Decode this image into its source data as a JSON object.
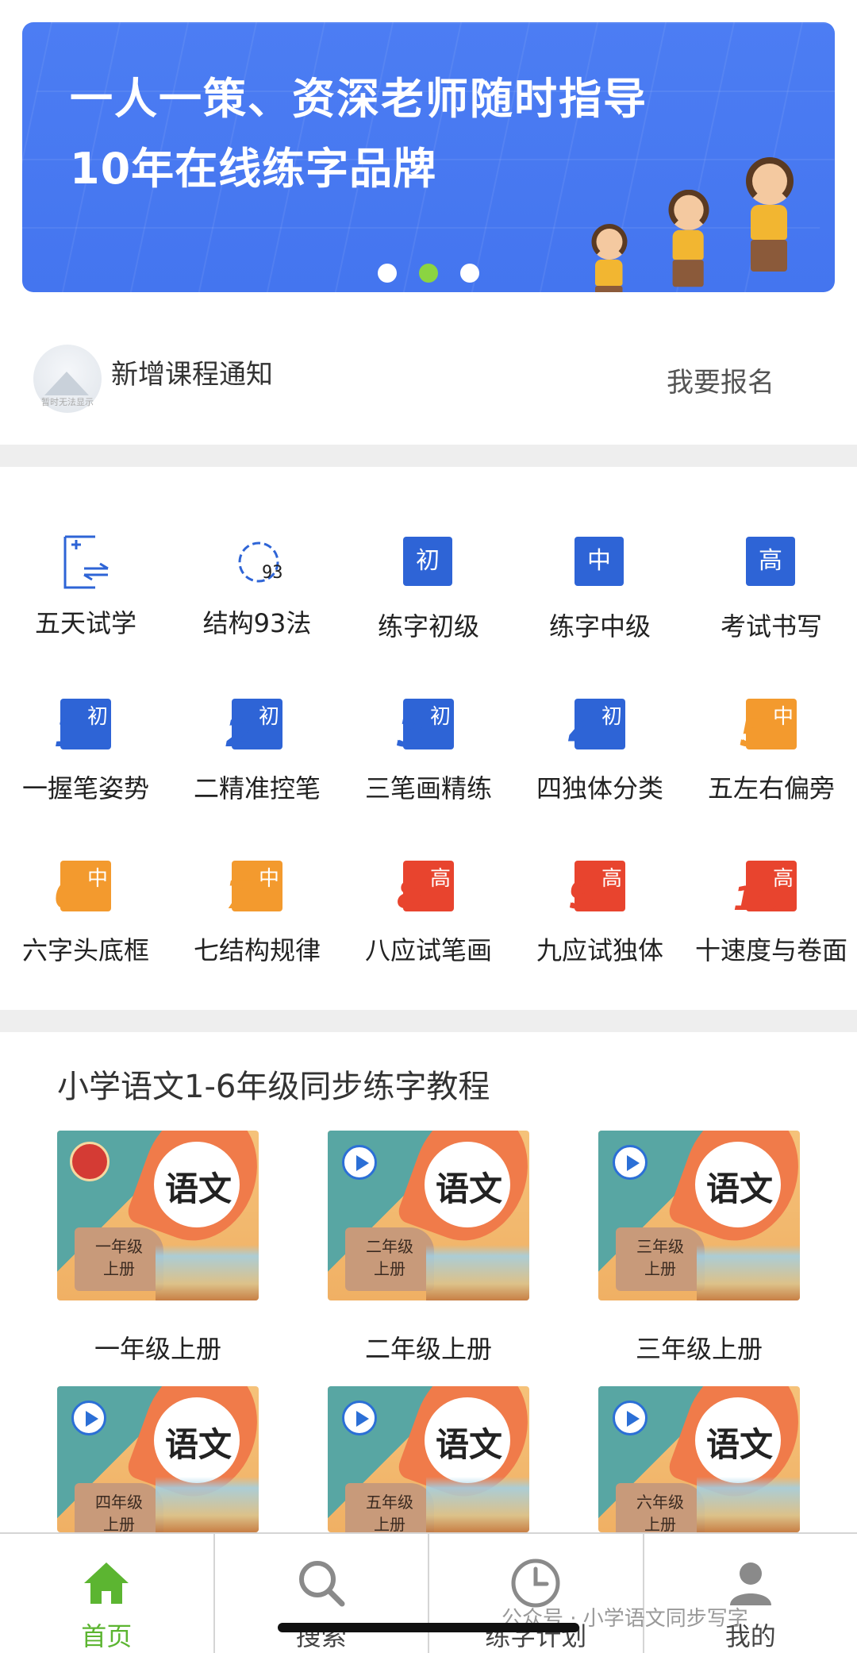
{
  "banner": {
    "line1": "一人一策、资深老师随时指导",
    "line2": "10年在线练字品牌",
    "dots": 3,
    "active_dot": 1,
    "accent": "#4c7df3"
  },
  "notice": {
    "avatar_caption": "暂时无法显示",
    "title": "新增课程通知",
    "signup": "我要报名"
  },
  "menu": {
    "row1": [
      {
        "label": "五天试学",
        "icon": "trial-icon"
      },
      {
        "label": "结构93法",
        "icon": "gear-93-icon"
      },
      {
        "label": "练字初级",
        "icon": "level-icon",
        "glyph": "初"
      },
      {
        "label": "练字中级",
        "icon": "level-icon",
        "glyph": "中"
      },
      {
        "label": "考试书写",
        "icon": "level-icon",
        "glyph": "高"
      }
    ],
    "row2": [
      {
        "label": "一握笔姿势",
        "num": "1",
        "glyph": "初"
      },
      {
        "label": "二精准控笔",
        "num": "2",
        "glyph": "初"
      },
      {
        "label": "三笔画精练",
        "num": "3",
        "glyph": "初"
      },
      {
        "label": "四独体分类",
        "num": "4",
        "glyph": "初"
      },
      {
        "label": "五左右偏旁",
        "num": "5",
        "glyph": "中"
      }
    ],
    "row3": [
      {
        "label": "六字头底框",
        "num": "6",
        "glyph": "中"
      },
      {
        "label": "七结构规律",
        "num": "7",
        "glyph": "中"
      },
      {
        "label": "八应试笔画",
        "num": "8",
        "glyph": "高"
      },
      {
        "label": "九应试独体",
        "num": "9",
        "glyph": "高"
      },
      {
        "label": "十速度与卷面",
        "num": "10",
        "glyph": "高"
      }
    ],
    "colors": {
      "blue": "#2e64d6",
      "orange": "#f39a2e",
      "red": "#e8442e"
    }
  },
  "section": {
    "title": "小学语文1-6年级同步练字教程",
    "cover_title": "语文",
    "books": [
      {
        "label": "一年级上册",
        "cover_grade": "一年级\n上册"
      },
      {
        "label": "二年级上册",
        "cover_grade": "二年级\n上册"
      },
      {
        "label": "三年级上册",
        "cover_grade": "三年级\n上册"
      },
      {
        "label": "",
        "cover_grade": "四年级\n上册"
      },
      {
        "label": "",
        "cover_grade": "五年级\n上册"
      },
      {
        "label": "",
        "cover_grade": "六年级\n上册"
      }
    ]
  },
  "tabs": [
    {
      "label": "首页",
      "icon": "home-icon",
      "active": true
    },
    {
      "label": "搜索",
      "icon": "search-icon",
      "active": false
    },
    {
      "label": "练字计划",
      "icon": "clock-icon",
      "active": false
    },
    {
      "label": "我的",
      "icon": "user-icon",
      "active": false
    }
  ],
  "watermark": "公众号 · 小学语文同步写字"
}
